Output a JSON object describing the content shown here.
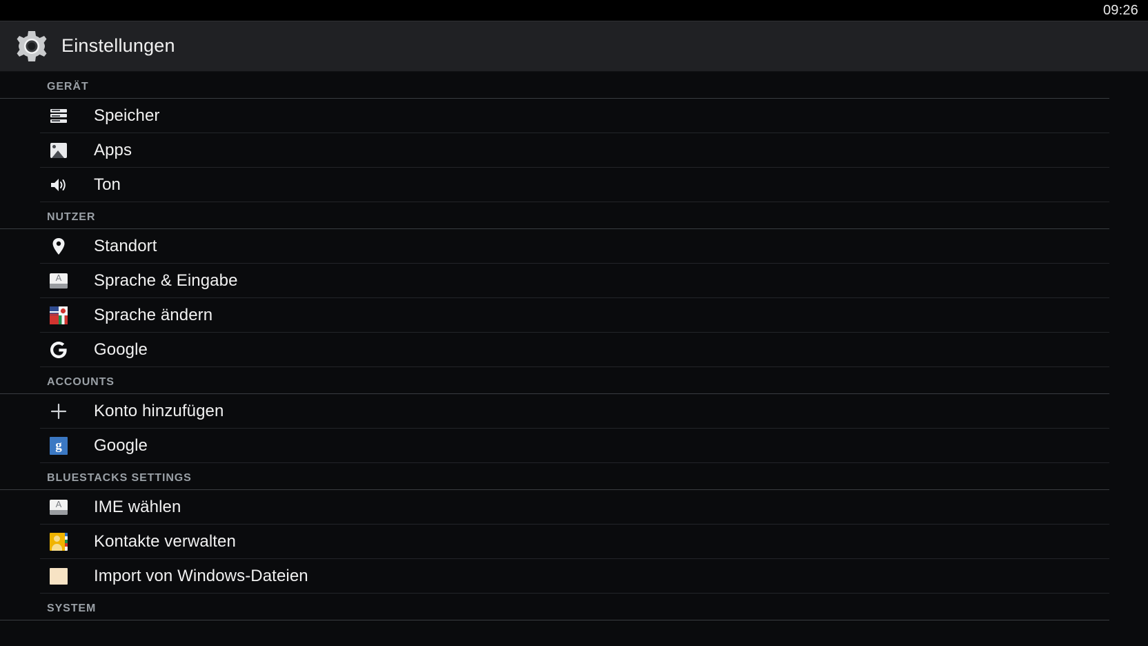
{
  "status_bar": {
    "clock": "09:26"
  },
  "action_bar": {
    "icon": "gear-icon",
    "title": "Einstellungen"
  },
  "colors": {
    "background": "#0a0b0d",
    "action_bar": "#202124",
    "text_primary": "#f1f1f1",
    "text_section": "#9aa0a6",
    "divider": "#232529",
    "divider_section": "#3a3d41",
    "accent_google_blue": "#3b78c3",
    "accent_contacts_yellow": "#f0b400",
    "accent_folder_beige": "#f7e3c4"
  },
  "sections": [
    {
      "header": "GERÄT",
      "items": [
        {
          "label": "Speicher",
          "icon": "storage-icon"
        },
        {
          "label": "Apps",
          "icon": "apps-image-icon"
        },
        {
          "label": "Ton",
          "icon": "sound-speaker-icon"
        }
      ]
    },
    {
      "header": "NUTZER",
      "items": [
        {
          "label": "Standort",
          "icon": "location-pin-icon"
        },
        {
          "label": "Sprache & Eingabe",
          "icon": "keyboard-icon"
        },
        {
          "label": "Sprache ändern",
          "icon": "flags-icon"
        },
        {
          "label": "Google",
          "icon": "google-g-icon"
        }
      ]
    },
    {
      "header": "ACCOUNTS",
      "items": [
        {
          "label": "Konto hinzufügen",
          "icon": "plus-icon"
        },
        {
          "label": "Google",
          "icon": "google-account-icon"
        }
      ]
    },
    {
      "header": "BLUESTACKS SETTINGS",
      "items": [
        {
          "label": "IME wählen",
          "icon": "keyboard-icon"
        },
        {
          "label": "Kontakte verwalten",
          "icon": "contacts-icon"
        },
        {
          "label": "Import von Windows-Dateien",
          "icon": "folder-icon"
        }
      ]
    },
    {
      "header": "SYSTEM",
      "items": []
    }
  ]
}
